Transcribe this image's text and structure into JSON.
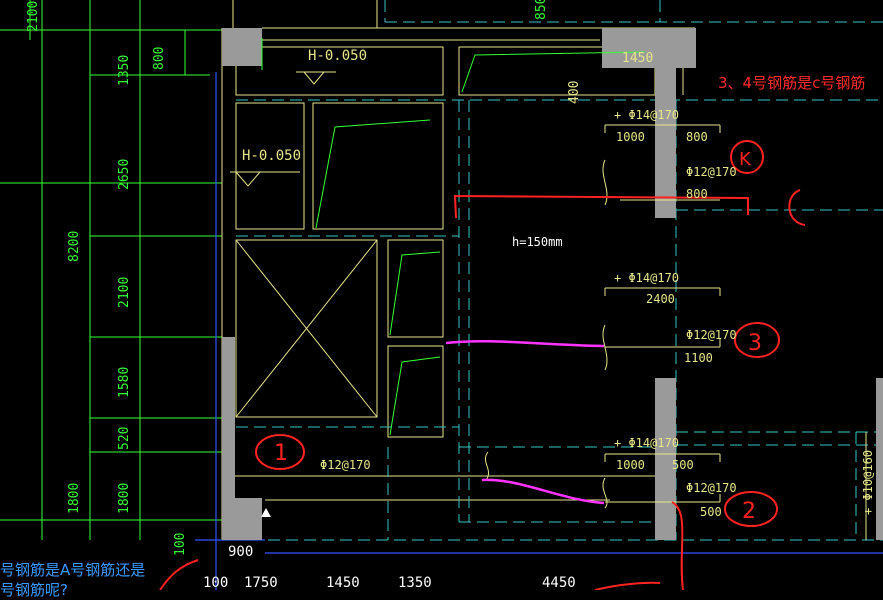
{
  "dims_left": {
    "top_cut": "2100",
    "d1350": "1350",
    "d800": "800",
    "d2650": "2650",
    "d8200": "8200",
    "d2100": "2100",
    "d1580": "1580",
    "d520": "520",
    "d1800a": "1800",
    "d1800b": "1800",
    "d100": "100"
  },
  "dims_top": {
    "d850": "850",
    "d1450": "1450",
    "d400": "400"
  },
  "dims_bottom": {
    "d900": "900",
    "d100": "100",
    "d1750": "1750",
    "d1450": "1450",
    "d1350": "1350",
    "d4450": "4450"
  },
  "elevations": {
    "e1": "H-0.050",
    "e2": "H-0.050"
  },
  "slab_thickness": "h=150mm",
  "rebars": {
    "top1_label": "+ Φ14@170",
    "top1_left": "1000",
    "top1_right": "800",
    "bot4_label": "Φ12@170",
    "bot4_len": "800",
    "top2_label": "+ Φ14@170",
    "top2_len": "2400",
    "bot3_label": "Φ12@170",
    "bot3_len": "1100",
    "top3_label": "+ Φ14@170",
    "top3_left": "1000",
    "top3_right": "500",
    "bot2_label": "Φ12@170",
    "bot2_len": "500",
    "bot1_label": "Φ12@170",
    "right_label": "+ Φ10@160"
  },
  "markers": {
    "m1": "1",
    "m2": "2",
    "m3": "3",
    "m4": "K"
  },
  "notes": {
    "red": "3、4号钢筋是c号钢筋",
    "blue_line1": "号钢筋是A号钢筋还是",
    "blue_line2": "号钢筋呢?"
  },
  "colors": {
    "background": "#000000",
    "dim_green": "#33ff33",
    "wall_grey": "#9a9a9a",
    "outline_yellow": "#e6e68a",
    "axis_cyan": "#36c6c6",
    "annotation_red": "#ff2222",
    "annotation_magenta": "#ff33ff",
    "axis_blue": "#3355ff"
  }
}
